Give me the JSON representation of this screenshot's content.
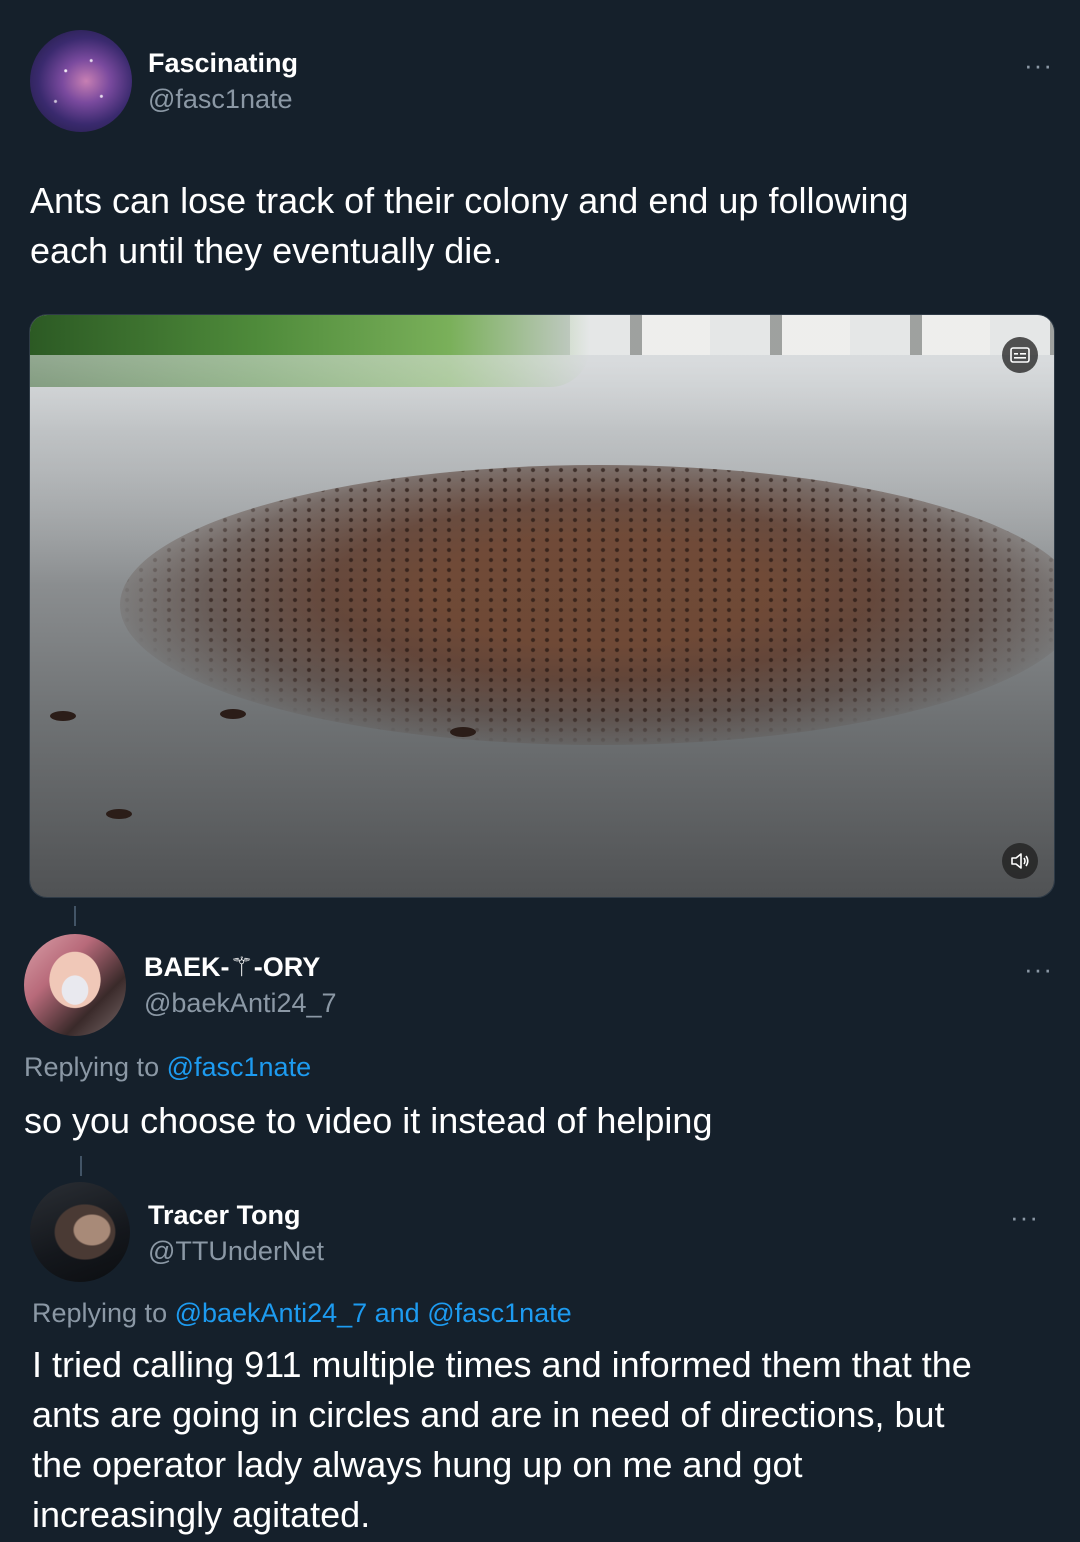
{
  "tweet1": {
    "name": "Fascinating",
    "handle": "@fasc1nate",
    "more": "···",
    "text_line1": "Ants can lose track of their colony and end up following",
    "text_line2": "each until they  eventually die."
  },
  "media": {
    "caption_icon": "captions-icon",
    "volume_icon": "volume-icon"
  },
  "tweet2": {
    "name": "BAEK-⚚-ORY",
    "handle": "@baekAnti24_7",
    "more": "···",
    "replying_prefix": "Replying to ",
    "replying_mention": "@fasc1nate",
    "text": "so you choose to video it instead of helping"
  },
  "tweet3": {
    "name": "Tracer Tong",
    "handle": "@TTUnderNet",
    "more": "···",
    "replying_prefix": "Replying to ",
    "replying_mentions": "@baekAnti24_7 and @fasc1nate",
    "text_line1": "I tried calling 911 multiple times and informed them that the",
    "text_line2": "ants are going in circles and are in need of directions, but",
    "text_line3": "the operator lady always hung up on me and got",
    "text_line4": "increasingly agitated."
  },
  "colors": {
    "background": "#15202b",
    "secondary_text": "#8b98a5",
    "link": "#1d9bf0"
  }
}
